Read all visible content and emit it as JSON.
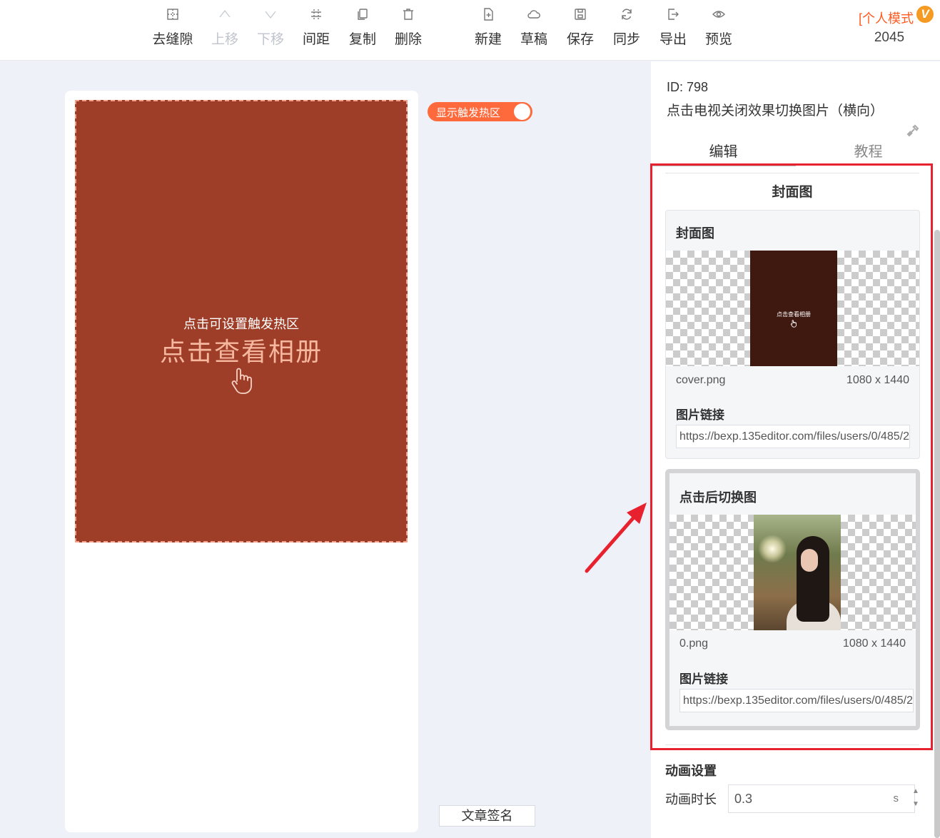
{
  "toolbar": {
    "buttons": [
      {
        "label": "去缝隙",
        "icon": "grid-dot-icon",
        "disabled": false
      },
      {
        "label": "上移",
        "icon": "chevron-up-icon",
        "disabled": true
      },
      {
        "label": "下移",
        "icon": "chevron-down-icon",
        "disabled": true
      },
      {
        "label": "间距",
        "icon": "spacing-icon",
        "disabled": false
      },
      {
        "label": "复制",
        "icon": "copy-icon",
        "disabled": false
      },
      {
        "label": "删除",
        "icon": "trash-icon",
        "disabled": false
      },
      {
        "label": "新建",
        "icon": "new-file-icon",
        "disabled": false
      },
      {
        "label": "草稿",
        "icon": "cloud-icon",
        "disabled": false
      },
      {
        "label": "保存",
        "icon": "save-icon",
        "disabled": false
      },
      {
        "label": "同步",
        "icon": "sync-icon",
        "disabled": false
      },
      {
        "label": "导出",
        "icon": "export-icon",
        "disabled": false
      },
      {
        "label": "预览",
        "icon": "eye-icon",
        "disabled": false
      }
    ],
    "mode_label": "[个人模式",
    "vip_badge": "V",
    "count": "2045"
  },
  "canvas": {
    "hotzone_tip": "点击可设置触发热区",
    "hotzone_title": "点击查看相册",
    "toggle_label": "显示触发热区",
    "sign_button": "文章签名"
  },
  "panel": {
    "id_text": "ID: 798",
    "template_name": "点击电视关闭效果切换图片（横向）",
    "tabs": {
      "edit": "编辑",
      "tutorial": "教程"
    },
    "section_title": "封面图",
    "cover": {
      "title": "封面图",
      "thumb_text": "点击查看相册",
      "filename": "cover.png",
      "size": "1080 x 1440",
      "link_label": "图片链接",
      "link_value": "https://bexp.135editor.com/files/users/0/485/2"
    },
    "switched": {
      "title": "点击后切换图",
      "filename": "0.png",
      "size": "1080 x 1440",
      "link_label": "图片链接",
      "link_value": "https://bexp.135editor.com/files/users/0/485/2"
    },
    "animation": {
      "title": "动画设置",
      "duration_label": "动画时长",
      "duration_value": "0.3",
      "unit": "s"
    }
  },
  "colors": {
    "accent": "#ff6a3d",
    "hotzone_bg": "#9f3e28",
    "highlight_box": "#e8212f"
  }
}
